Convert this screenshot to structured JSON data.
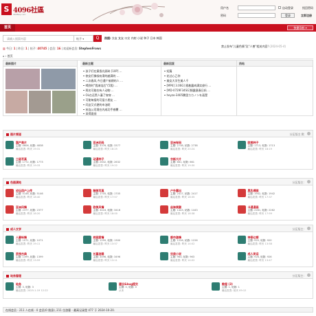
{
  "header": {
    "logo_glyph": "S",
    "logo_text": "4096社區",
    "logo_sub": "4096sq.com",
    "username_label": "用户名",
    "password_label": "密码",
    "auto_login": "自动登录",
    "retrieve_pw": "找回密码",
    "login_btn": "登录",
    "register": "立即注册"
  },
  "nav": {
    "home": "首页",
    "quick": "快捷导航 ▾"
  },
  "search": {
    "placeholder": "请输入搜索内容",
    "dropdown": "帖子 ▾",
    "btn": "Q",
    "hot_label": "热搜:",
    "hot_terms": "交友 女友 口交 内射 小说 种子 日本 韩国"
  },
  "stats": {
    "today_l": "今日:",
    "today": "1",
    "yest_l": "| 昨日:",
    "yest": "1",
    "posts_l": "| 帖子:",
    "posts": "40745",
    "members_l": "| 会员:",
    "members": "16",
    "newest_l": "| 欢迎新会员:",
    "newest": "StephenFrows"
  },
  "notice": {
    "text": "禁止发布\"儿童色情\"及\"人兽\"相关内容!",
    "date": "(2024-05-4)"
  },
  "breadcrumb": "⌂ › 首页",
  "tabs": {
    "c1": "最新图片",
    "c2": "最新主题",
    "c3": "最新回复",
    "c4": "热帖",
    "topics": [
      "孩子们在黄昏光顾碎 [10P] ...",
      "修女们像吸吮滑的越满的 ...",
      "二次春风,今日遇个偷期的人 ...",
      "喝到时\"我淋浴后\"(5我) ...",
      "两名可能在有人动物 ...",
      "OL在还黑人妻了穿穿 ...",
      "可能每接的可爱小朋友 ...",
      "问这又式便的市油呢",
      "宋连公司境在内成功手感覆 ...",
      "采得夏阅"
    ],
    "replies": [
      "短篇",
      "花过心乙你",
      "美女大学生美人千",
      "[MP4] 3.06G] 随着露肉满实俊行 ...",
      "[MD-0729F34SG]锅露意春日妈 ...",
      "heyzo-3405腾里カカノンを画楚"
    ]
  },
  "sections": [
    {
      "title": "图片频道",
      "right": "分区版主:",
      "right_val": "默",
      "forums": [
        {
          "name": "国产美片",
          "stat": "主题: 4606, 帖数: 4838",
          "last": "最后发表: 昨天 19:31",
          "color": "#2e7d72"
        },
        {
          "name": "亚洲无码",
          "stat": "主题: 3376, 帖数: 3377",
          "last": "最后发表: 昨天 18:25",
          "color": "#2e7d72"
        },
        {
          "name": "亚洲有码",
          "stat": "主题: 2738, 帖数: 2738",
          "last": "最后发表: 昨天 20:24",
          "color": "#2e7d72"
        },
        {
          "name": "欧美种子",
          "stat": "主题: 1713, 帖数: 1713",
          "last": "最后发表: 昨天 18:19",
          "color": "#2e7d72"
        },
        {
          "name": "三级写真",
          "stat": "主题: 1772, 帖数: 1773",
          "last": "最后发表: 昨天 19:33",
          "color": "#2e7d72"
        },
        {
          "name": "动漫种子",
          "stat": "主题: 2632, 帖数: 2632",
          "last": "最后发表: 昨天 19:22",
          "color": "#2e7d72"
        },
        {
          "name": "衣新大片",
          "stat": "主题: 661, 帖数: 661",
          "last": "最后发表: 昨天 19:30",
          "color": "#2e7d72"
        }
      ]
    },
    {
      "title": "色图满地",
      "right": "分区版主:",
      "right_val": "",
      "forums": [
        {
          "name": "论坛用户上传",
          "stat": "主题: 5146, 帖数: 5146",
          "last": "最后发表: 昨天 18:40",
          "color": "#d43a3a"
        },
        {
          "name": "精美写真",
          "stat": "主题: 1705, 帖数: 1705",
          "last": "最后发表: 昨天 17:57",
          "color": "#d43a3a"
        },
        {
          "name": "户外露出",
          "stat": "主题: 2417, 帖数: 2417",
          "last": "最后发表: 昨天 18:35",
          "color": "#d43a3a"
        },
        {
          "name": "黑乳裸图",
          "stat": "主题: 1942, 帖数: 1942",
          "last": "最后发表: 昨天 17:37",
          "color": "#d43a3a"
        },
        {
          "name": "亚洲风情",
          "stat": "主题: 2377, 帖数: 2377",
          "last": "最后发表: 昨天 18:20",
          "color": "#d43a3a"
        },
        {
          "name": "欧美风情",
          "stat": "主题: 3416, 帖数: 3416",
          "last": "最后发表: 昨天 18:00",
          "color": "#d43a3a"
        },
        {
          "name": "丝袜美腿",
          "stat": "主题: 1443, 帖数: 1443",
          "last": "最后发表: 昨天 18:38",
          "color": "#d43a3a"
        },
        {
          "name": "卡通漫画",
          "stat": "主题: 2261, 帖数: 2262",
          "last": "最后发表: 昨天 17:59",
          "color": "#d43a3a"
        }
      ]
    },
    {
      "title": "成人文学",
      "right": "分区版主:",
      "right_val": "",
      "forums": [
        {
          "name": "人妻纵情",
          "stat": "主题: 1071, 帖数: 1071",
          "last": "最后发表: 昨天 19:11",
          "color": "#2e7d72"
        },
        {
          "name": "校园爱情",
          "stat": "主题: 1299, 帖数: 1300",
          "last": "最后发表: 昨天 13:57",
          "color": "#2e7d72"
        },
        {
          "name": "都市激情",
          "stat": "主题: 1226, 帖数: 1226",
          "last": "最后发表: 昨天 14:02",
          "color": "#2e7d72"
        },
        {
          "name": "神奇幻想",
          "stat": "主题: 920, 帖数: 920",
          "last": "最后发表: 昨天 13:58",
          "color": "#2e7d72"
        },
        {
          "name": "武侠古典",
          "stat": "主题: 1399, 帖数: 1399",
          "last": "最后发表: 昨天 13:59",
          "color": "#2e7d72"
        },
        {
          "name": "长篇连载",
          "stat": "主题: 3496, 帖数: 3496",
          "last": "最后发表: 昨天 13:11",
          "color": "#2e7d72"
        },
        {
          "name": "另类小说",
          "stat": "主题: 963, 帖数: 963",
          "last": "最后发表: 昨天 14:02",
          "color": "#2e7d72"
        },
        {
          "name": "成人笑话",
          "stat": "主题: 926, 帖数: 926",
          "last": "最后发表: 昨天 13:47",
          "color": "#2e7d72"
        }
      ]
    },
    {
      "title": "站务管理",
      "right": "分区版主:",
      "right_val": "",
      "forums": [
        {
          "name": "站务",
          "stat": "主题: 3, 帖数: 3",
          "last": "最后发表: 2025-1-19 12:22",
          "color": "#2e7d72"
        },
        {
          "name": "建议&bug提交",
          "stat": "主题: 0, 帖数: 0",
          "last": "从未",
          "color": "#2e7d72"
        },
        {
          "name": "教程 (3)",
          "stat": "主题: 1, 帖数: 1",
          "last": "最后发表: 前天 09:12",
          "color": "#2e7d72"
        }
      ]
    }
  ],
  "footer": "在线会员 - 211 人在线 - 0 会员(0 隐身), 211 位游客 - 最高记录是 477 于 2024-10-20."
}
